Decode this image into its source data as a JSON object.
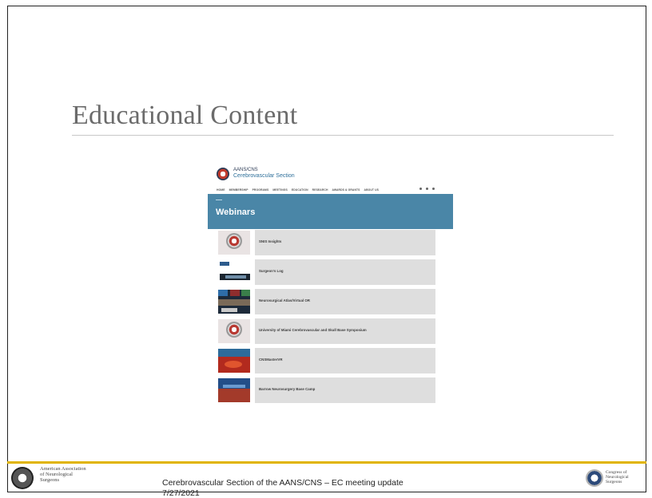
{
  "slide": {
    "title": "Educational Content"
  },
  "site": {
    "org": "AANS/CNS",
    "section": "Cerebrovascular Section",
    "nav": [
      "HOME",
      "MEMBERSHIP",
      "PROGRAMS",
      "MEETINGS",
      "EDUCATION",
      "RESEARCH",
      "AWARDS & GRANTS",
      "ABOUT US"
    ],
    "banner_title": "Webinars",
    "items": [
      {
        "label": "SNIS Insights",
        "thumb": "seal"
      },
      {
        "label": "Surgeon's Log",
        "thumb": "log"
      },
      {
        "label": "Neurosurgical Atlas/Virtual OR",
        "thumb": "atlas"
      },
      {
        "label": "University of Miami Cerebrovascular and Skull Base Symposium",
        "thumb": "seal"
      },
      {
        "label": "CNSMasterVR",
        "thumb": "vr"
      },
      {
        "label": "Barrow Neurosurgery Base Camp",
        "thumb": "barrow"
      }
    ]
  },
  "footer": {
    "left_org": "American Association of Neurological Surgeons",
    "text": "Cerebrovascular Section of the AANS/CNS – EC meeting update",
    "date": "7/27/2021",
    "right_org": "Congress of Neurological Surgeons",
    "accent_color": "#e0b400"
  }
}
